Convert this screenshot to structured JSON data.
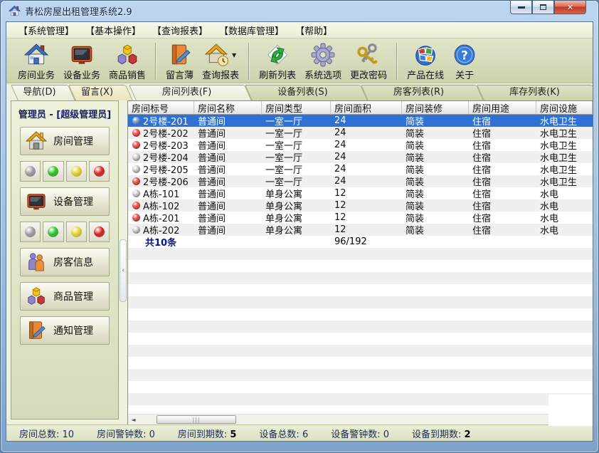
{
  "window": {
    "title": "青松房屋出租管理系统2.9"
  },
  "menu_bar": {
    "items": [
      "【系统管理】",
      "【基本操作】",
      "【查询报表】",
      "【数据库管理】",
      "【帮助】"
    ]
  },
  "toolbar": {
    "buttons": [
      {
        "label": "房间业务",
        "icon": "house-blue-icon"
      },
      {
        "label": "设备业务",
        "icon": "tv-icon"
      },
      {
        "label": "商品销售",
        "icon": "cubes-icon",
        "sep_after": true
      },
      {
        "label": "留言薄",
        "icon": "book-pen-icon"
      },
      {
        "label": "查询报表",
        "icon": "report-house-icon",
        "dropdown": true,
        "sep_after": true
      },
      {
        "label": "刷新列表",
        "icon": "refresh-icon"
      },
      {
        "label": "系统选项",
        "icon": "gear-icon"
      },
      {
        "label": "更改密码",
        "icon": "keys-icon",
        "sep_after": true
      },
      {
        "label": "产品在线",
        "icon": "windows-globe-icon"
      },
      {
        "label": "关于",
        "icon": "question-icon"
      }
    ]
  },
  "side_tabs": [
    {
      "label": "导航(D)",
      "active": true
    },
    {
      "label": "留言(X)",
      "active": false
    }
  ],
  "main_tabs": [
    {
      "label": "房间列表(F)",
      "active": true
    },
    {
      "label": "设备列表(S)",
      "active": false
    },
    {
      "label": "房客列表(R)",
      "active": false
    },
    {
      "label": "库存列表(K)",
      "active": false
    }
  ],
  "sidebar": {
    "user_label": "管理员 - [超级管理员]",
    "buttons": [
      {
        "label": "房间管理",
        "icon": "house-gold-icon",
        "lights_after": true
      },
      {
        "label": "设备管理",
        "icon": "tv-icon",
        "lights_after": true
      },
      {
        "label": "房客信息",
        "icon": "people-icon"
      },
      {
        "label": "商品管理",
        "icon": "cubes-icon"
      },
      {
        "label": "通知管理",
        "icon": "book-pen-icon"
      }
    ],
    "lights": [
      {
        "name": "gray",
        "color": "#9e9e9e"
      },
      {
        "name": "green",
        "color": "#2ec22e"
      },
      {
        "name": "yellow",
        "color": "#e2d52e"
      },
      {
        "name": "red",
        "color": "#d22424"
      }
    ]
  },
  "table": {
    "columns": [
      "房间标号",
      "房间名称",
      "房间类型",
      "房间面积",
      "房间装修",
      "房间用途",
      "房间设施"
    ],
    "rows": [
      {
        "id": "2号楼-201",
        "name": "普通间",
        "type": "一室一厅",
        "area": "24",
        "decoration": "简装",
        "usage": "住宿",
        "facilities": "水电卫生",
        "dot": "blue",
        "selected": true
      },
      {
        "id": "2号楼-202",
        "name": "普通间",
        "type": "一室一厅",
        "area": "24",
        "decoration": "简装",
        "usage": "住宿",
        "facilities": "水电卫生",
        "dot": "red"
      },
      {
        "id": "2号楼-203",
        "name": "普通间",
        "type": "一室一厅",
        "area": "24",
        "decoration": "简装",
        "usage": "住宿",
        "facilities": "水电卫生",
        "dot": "red"
      },
      {
        "id": "2号楼-204",
        "name": "普通间",
        "type": "一室一厅",
        "area": "24",
        "decoration": "简装",
        "usage": "住宿",
        "facilities": "水电卫生",
        "dot": "gray"
      },
      {
        "id": "2号楼-205",
        "name": "普通间",
        "type": "一室一厅",
        "area": "24",
        "decoration": "简装",
        "usage": "住宿",
        "facilities": "水电卫生",
        "dot": "gray"
      },
      {
        "id": "2号楼-206",
        "name": "普通间",
        "type": "一室一厅",
        "area": "24",
        "decoration": "简装",
        "usage": "住宿",
        "facilities": "水电卫生",
        "dot": "red"
      },
      {
        "id": "A栋-101",
        "name": "普通间",
        "type": "单身公寓",
        "area": "12",
        "decoration": "简装",
        "usage": "住宿",
        "facilities": "水电",
        "dot": "gray"
      },
      {
        "id": "A栋-102",
        "name": "普通间",
        "type": "单身公寓",
        "area": "12",
        "decoration": "简装",
        "usage": "住宿",
        "facilities": "水电",
        "dot": "red"
      },
      {
        "id": "A栋-201",
        "name": "普通间",
        "type": "单身公寓",
        "area": "12",
        "decoration": "简装",
        "usage": "住宿",
        "facilities": "水电",
        "dot": "red"
      },
      {
        "id": "A栋-202",
        "name": "普通间",
        "type": "单身公寓",
        "area": "12",
        "decoration": "简装",
        "usage": "住宿",
        "facilities": "水电",
        "dot": "gray"
      }
    ],
    "summary": {
      "count": "共10条",
      "area_total": "96/192"
    },
    "dot_colors": {
      "blue": "#4a7ab8",
      "red": "#cc1f1f",
      "gray": "#9a9a9a"
    },
    "selected_row_color": "#2e71d5"
  },
  "status_bar": {
    "items": [
      {
        "label": "房间总数",
        "value": "10"
      },
      {
        "label": "房间警钟数",
        "value": "0"
      },
      {
        "label": "房间到期数",
        "value": "5",
        "bold": true
      },
      {
        "label": "设备总数",
        "value": "6"
      },
      {
        "label": "设备警钟数",
        "value": "0"
      },
      {
        "label": "设备到期数",
        "value": "2",
        "bold": true
      }
    ]
  }
}
